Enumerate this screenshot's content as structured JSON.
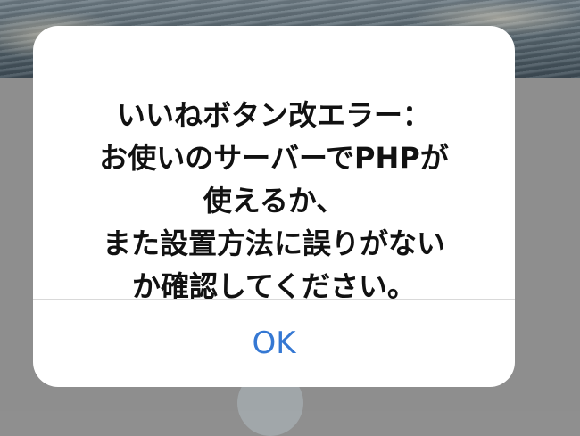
{
  "alert": {
    "message_lines": [
      "いいねボタン改エラー：",
      "お使いのサーバーでPHPが",
      "使えるか、",
      "また設置方法に誤りがない",
      "か確認してください。"
    ],
    "ok_label": "OK"
  },
  "colors": {
    "button_text": "#3578d3",
    "message_text": "#111111",
    "dialog_background": "#ffffff",
    "overlay": "#8e8e8e"
  }
}
